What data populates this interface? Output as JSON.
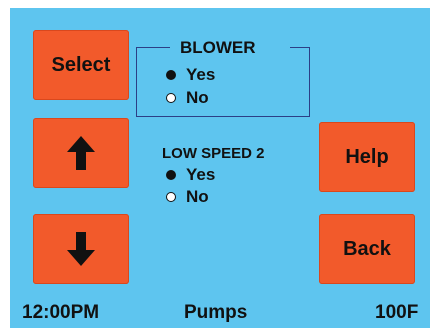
{
  "buttons": {
    "select_label": "Select",
    "help_label": "Help",
    "back_label": "Back",
    "up_icon": "arrow-up",
    "down_icon": "arrow-down"
  },
  "blower": {
    "title": "BLOWER",
    "options": [
      {
        "label": "Yes",
        "selected": true
      },
      {
        "label": "No",
        "selected": false
      }
    ]
  },
  "low_speed_2": {
    "title": "LOW SPEED 2",
    "options": [
      {
        "label": "Yes",
        "selected": true
      },
      {
        "label": "No",
        "selected": false
      }
    ]
  },
  "status_bar": {
    "time": "12:00PM",
    "page": "Pumps",
    "temperature": "100F"
  },
  "colors": {
    "screen_bg": "#5ec5ef",
    "button_bg": "#f25a2b",
    "group_border": "#2c3f86",
    "text": "#111111"
  }
}
